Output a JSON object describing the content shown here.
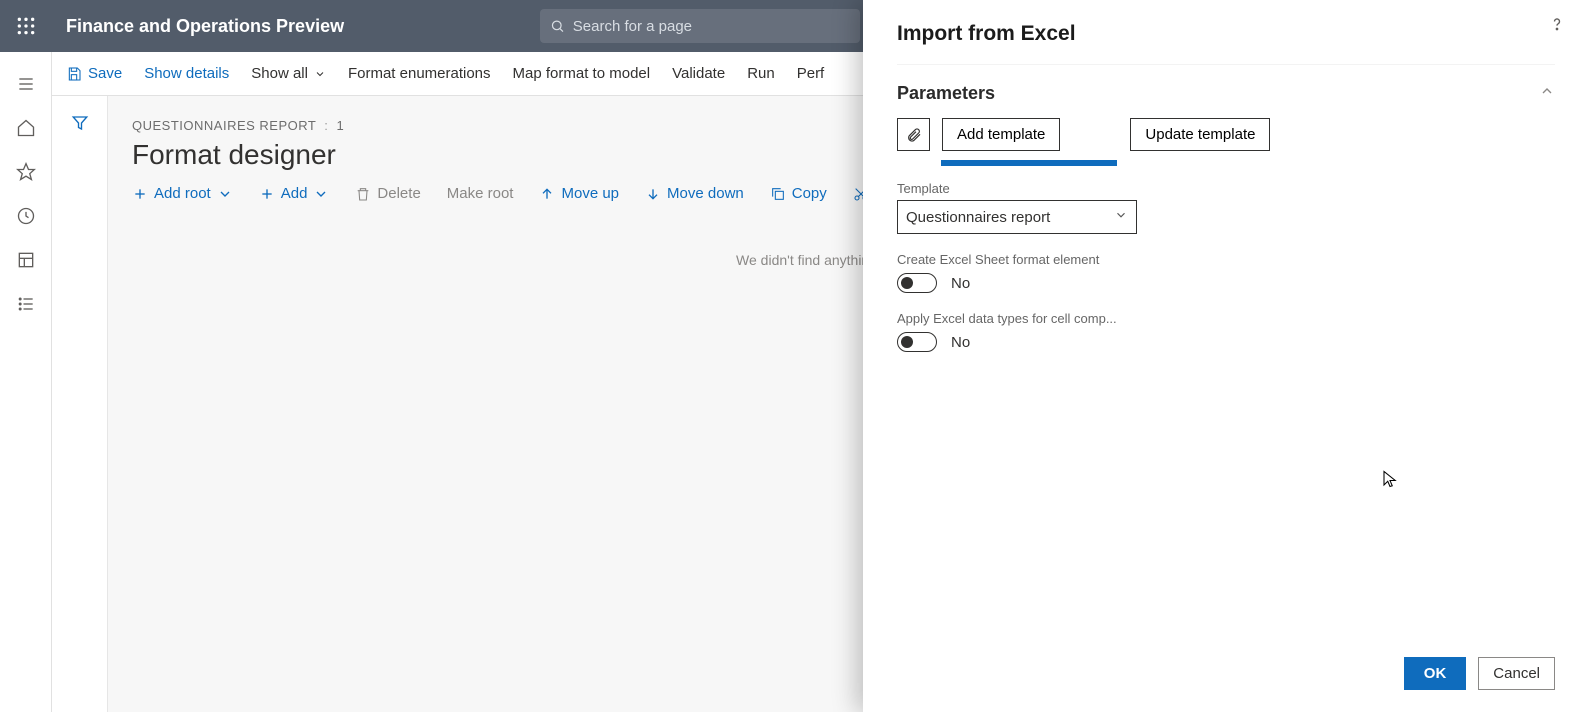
{
  "header": {
    "app_title": "Finance and Operations Preview",
    "search_placeholder": "Search for a page"
  },
  "toolbar": {
    "save": "Save",
    "show_details": "Show details",
    "show_all": "Show all",
    "format_enum": "Format enumerations",
    "map_format": "Map format to model",
    "validate": "Validate",
    "run": "Run",
    "perf": "Perf"
  },
  "content": {
    "breadcrumb_title": "QUESTIONNAIRES REPORT",
    "breadcrumb_num": "1",
    "page_title": "Format designer",
    "empty": "We didn't find anything to show here."
  },
  "designer_toolbar": {
    "add_root": "Add root",
    "add": "Add",
    "delete": "Delete",
    "make_root": "Make root",
    "move_up": "Move up",
    "move_down": "Move down",
    "copy": "Copy",
    "cut": "Cut"
  },
  "flyout": {
    "title": "Import from Excel",
    "section": "Parameters",
    "add_template": "Add template",
    "update_template": "Update template",
    "template_label": "Template",
    "template_value": "Questionnaires report",
    "create_sheet_label": "Create Excel Sheet format element",
    "create_sheet_value": "No",
    "apply_types_label": "Apply Excel data types for cell comp...",
    "apply_types_value": "No",
    "ok": "OK",
    "cancel": "Cancel"
  }
}
